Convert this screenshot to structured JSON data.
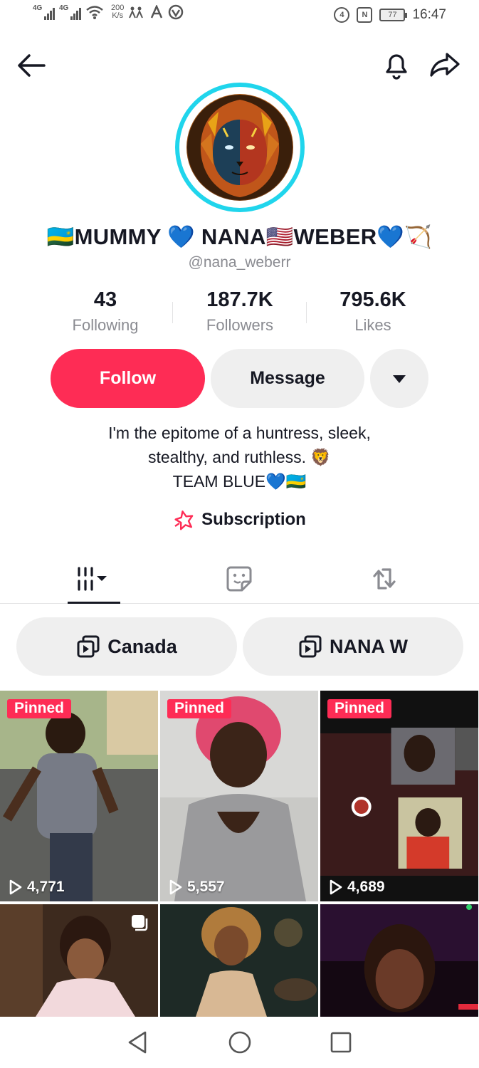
{
  "status_bar": {
    "network1": "4G",
    "network2": "4G",
    "speed_value": "200",
    "speed_unit": "K/s",
    "battery": "77",
    "time": "16:47"
  },
  "profile": {
    "display_name": "🇷🇼MUMMY 💙 NANA🇺🇸WEBER💙🏹",
    "handle": "@nana_weberr",
    "stats": [
      {
        "value": "43",
        "label": "Following"
      },
      {
        "value": "187.7K",
        "label": "Followers"
      },
      {
        "value": "795.6K",
        "label": "Likes"
      }
    ],
    "follow_label": "Follow",
    "message_label": "Message",
    "bio_lines": [
      "I'm the epitome of a huntress, sleek,",
      "stealthy, and ruthless. 🦁",
      "TEAM BLUE💙🇷🇼"
    ],
    "subscription_label": "Subscription"
  },
  "tabs": [
    {
      "icon": "videos-grid-icon",
      "active": true
    },
    {
      "icon": "sticker-icon",
      "active": false
    },
    {
      "icon": "repost-icon",
      "active": false
    }
  ],
  "playlists": [
    {
      "label": "Canada",
      "icon": "playlist-icon"
    },
    {
      "label": "NANA W",
      "icon": "playlist-icon"
    }
  ],
  "videos": [
    {
      "pinned_label": "Pinned",
      "views": "4,771"
    },
    {
      "pinned_label": "Pinned",
      "views": "5,557"
    },
    {
      "pinned_label": "Pinned",
      "views": "4,689"
    },
    {
      "pinned_label": "",
      "views": ""
    },
    {
      "pinned_label": "",
      "views": ""
    },
    {
      "pinned_label": "",
      "views": ""
    }
  ],
  "colors": {
    "accent": "#fe2c55",
    "avatar_ring": "#20d5ec",
    "secondary_text": "#8a8b91",
    "button_gray": "#efefef"
  }
}
